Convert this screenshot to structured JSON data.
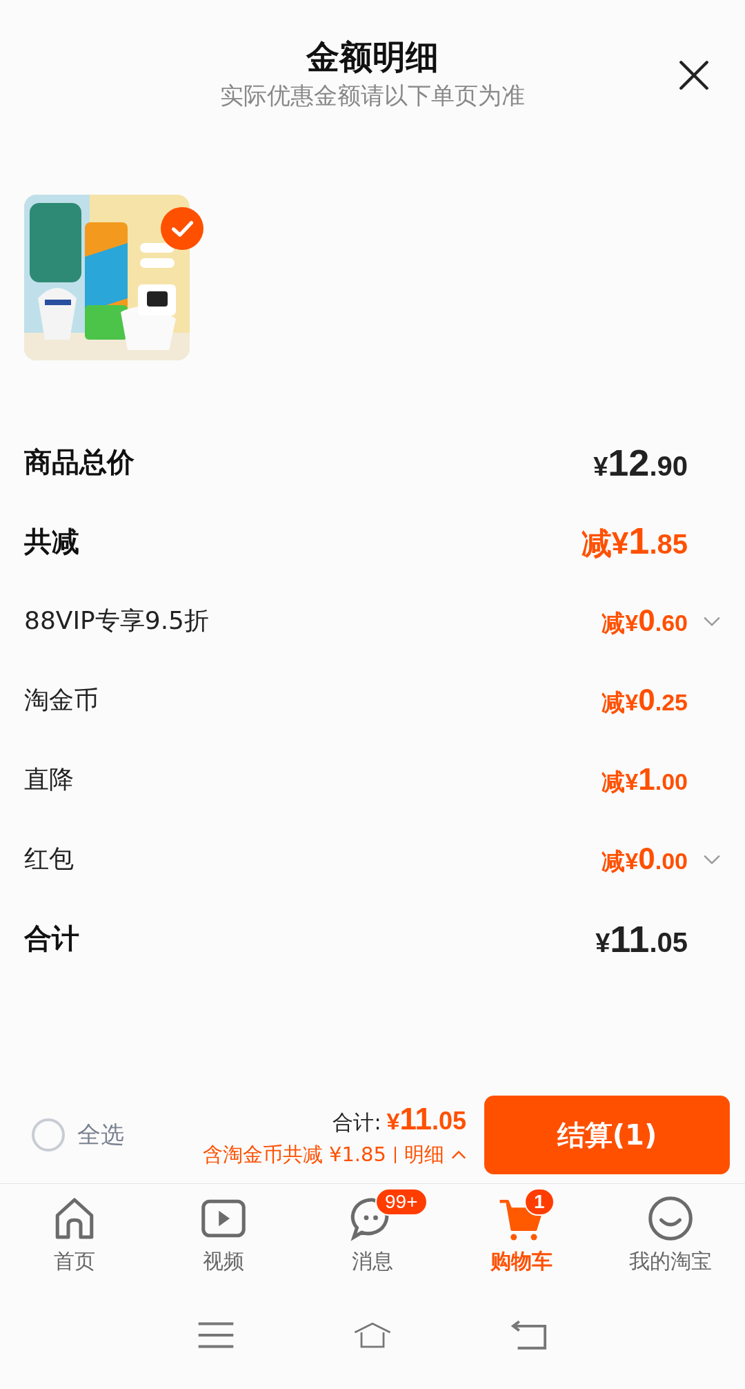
{
  "header": {
    "title": "金额明细",
    "subtitle": "实际优惠金额请以下单页为准"
  },
  "product": {
    "selected": true
  },
  "rows": [
    {
      "kind": "total",
      "label": "商品总价",
      "prefix": "¥",
      "integer": "12",
      "decimal": ".90",
      "expandable": false
    },
    {
      "kind": "discount_total",
      "label": "共减",
      "prefix": "减¥",
      "integer": "1",
      "decimal": ".85",
      "expandable": false
    },
    {
      "kind": "discount",
      "label": "88VIP专享9.5折",
      "prefix": "减¥",
      "integer": "0",
      "decimal": ".60",
      "expandable": true
    },
    {
      "kind": "discount",
      "label": "淘金币",
      "prefix": "减¥",
      "integer": "0",
      "decimal": ".25",
      "expandable": false
    },
    {
      "kind": "discount",
      "label": "直降",
      "prefix": "减¥",
      "integer": "1",
      "decimal": ".00",
      "expandable": false
    },
    {
      "kind": "discount",
      "label": "红包",
      "prefix": "减¥",
      "integer": "0",
      "decimal": ".00",
      "expandable": true
    },
    {
      "kind": "total",
      "label": "合计",
      "prefix": "¥",
      "integer": "11",
      "decimal": ".05",
      "expandable": false
    }
  ],
  "checkout_bar": {
    "select_all": {
      "label": "全选",
      "checked": false
    },
    "total_label": "合计:",
    "total": {
      "prefix": "¥",
      "integer": "11",
      "decimal": ".05"
    },
    "savings": "含淘金币共减 ¥1.85",
    "details_link": "明细",
    "button": "结算(1)"
  },
  "tabs": [
    {
      "label": "首页",
      "selected": false
    },
    {
      "label": "视频",
      "selected": false
    },
    {
      "label": "消息",
      "selected": false,
      "badge": "99+"
    },
    {
      "label": "购物车",
      "selected": true,
      "badge": "1"
    },
    {
      "label": "我的淘宝",
      "selected": false
    }
  ]
}
